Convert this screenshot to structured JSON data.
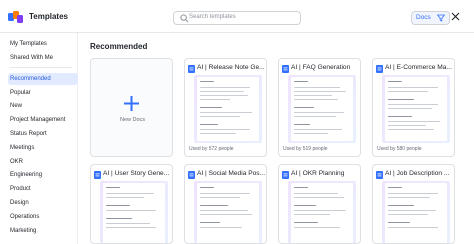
{
  "app": {
    "title": "Templates",
    "search_placeholder": "Search templates",
    "filter_label": "Docs"
  },
  "sidebar": {
    "items": [
      {
        "label": "My Templates"
      },
      {
        "label": "Shared With Me"
      },
      {
        "label": "Recommended",
        "active": true
      },
      {
        "label": "Popular"
      },
      {
        "label": "New"
      },
      {
        "label": "Project Management"
      },
      {
        "label": "Status Report"
      },
      {
        "label": "Meetings"
      },
      {
        "label": "OKR"
      },
      {
        "label": "Engineering"
      },
      {
        "label": "Product"
      },
      {
        "label": "Design"
      },
      {
        "label": "Operations"
      },
      {
        "label": "Marketing"
      }
    ]
  },
  "main": {
    "section_title": "Recommended",
    "new_card_label": "New Docs",
    "templates": [
      {
        "title": "AI | Release Note Ge...",
        "usage": "Used by 572 people"
      },
      {
        "title": "AI | FAQ Generation",
        "usage": "Used by 519 people"
      },
      {
        "title": "AI | E-Commerce Ma...",
        "usage": "Used by 580 people"
      },
      {
        "title": "AI | User Story Gene...",
        "usage": ""
      },
      {
        "title": "AI | Social Media Pos...",
        "usage": ""
      },
      {
        "title": "AI | OKR Planning",
        "usage": ""
      },
      {
        "title": "AI | Job Description ...",
        "usage": ""
      }
    ]
  },
  "colors": {
    "accent": "#3370ff",
    "active_bg": "#e1eaff",
    "preview_gradient_start": "#efe4ff",
    "preview_gradient_end": "#e8f0ff"
  },
  "icons": {
    "logo": "templates-logo-icon",
    "search": "search-icon",
    "filter": "filter-icon",
    "close": "close-icon",
    "new": "plus-icon",
    "doc": "doc-icon"
  }
}
